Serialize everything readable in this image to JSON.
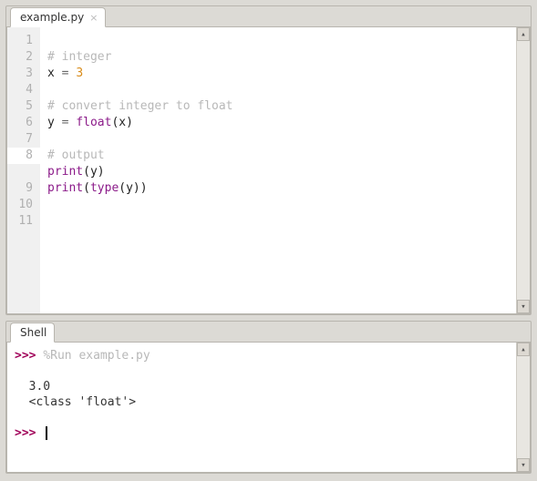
{
  "editor": {
    "tab_label": "example.py",
    "line_count": 11,
    "highlighted_line": 8,
    "code_lines": [
      {
        "tokens": []
      },
      {
        "tokens": [
          {
            "t": "# integer",
            "c": "comment"
          }
        ]
      },
      {
        "tokens": [
          {
            "t": "x ",
            "c": "ident"
          },
          {
            "t": "= ",
            "c": "op"
          },
          {
            "t": "3",
            "c": "num"
          }
        ]
      },
      {
        "tokens": []
      },
      {
        "tokens": [
          {
            "t": "# convert integer to float",
            "c": "comment"
          }
        ]
      },
      {
        "tokens": [
          {
            "t": "y ",
            "c": "ident"
          },
          {
            "t": "= ",
            "c": "op"
          },
          {
            "t": "float",
            "c": "builtin"
          },
          {
            "t": "(x)",
            "c": "ident"
          }
        ]
      },
      {
        "tokens": []
      },
      {
        "tokens": [
          {
            "t": "# output",
            "c": "comment"
          }
        ]
      },
      {
        "tokens": [
          {
            "t": "print",
            "c": "builtin"
          },
          {
            "t": "(y)",
            "c": "ident"
          }
        ]
      },
      {
        "tokens": [
          {
            "t": "print",
            "c": "builtin"
          },
          {
            "t": "(",
            "c": "ident"
          },
          {
            "t": "type",
            "c": "builtin"
          },
          {
            "t": "(y))",
            "c": "ident"
          }
        ]
      },
      {
        "tokens": []
      }
    ]
  },
  "shell": {
    "tab_label": "Shell",
    "lines": [
      {
        "type": "cmd",
        "prompt": ">>> ",
        "text": "%Run example.py"
      },
      {
        "type": "blank"
      },
      {
        "type": "out",
        "text": "  3.0"
      },
      {
        "type": "out",
        "text": "  <class 'float'>"
      },
      {
        "type": "blank"
      },
      {
        "type": "prompt_cursor",
        "prompt": ">>> "
      }
    ]
  },
  "scroll": {
    "up": "▴",
    "down": "▾"
  }
}
